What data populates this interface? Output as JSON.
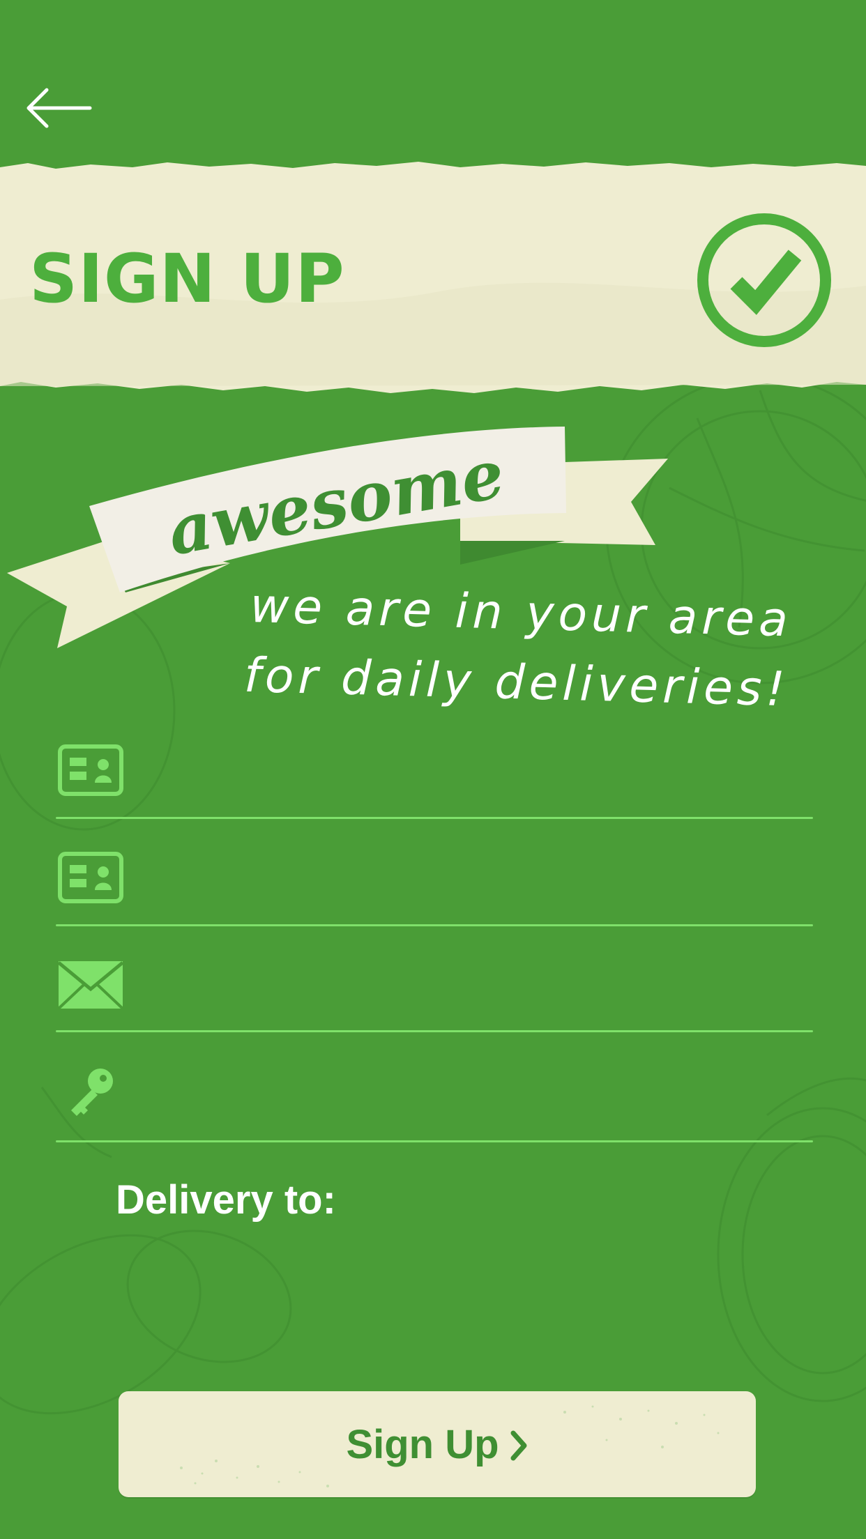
{
  "header": {
    "title": "SIGN UP",
    "back_icon": "arrow-left-icon",
    "confirm_icon": "check-circle-icon"
  },
  "banner": {
    "word": "awesome",
    "tagline_line1": "we are in your area",
    "tagline_line2": "for daily deliveries!"
  },
  "form": {
    "fields": [
      {
        "icon": "id-card-icon",
        "value": "",
        "placeholder": ""
      },
      {
        "icon": "id-card-icon",
        "value": "",
        "placeholder": ""
      },
      {
        "icon": "envelope-icon",
        "value": "",
        "placeholder": ""
      },
      {
        "icon": "key-icon",
        "value": "",
        "placeholder": ""
      }
    ],
    "delivery_label": "Delivery to:"
  },
  "actions": {
    "signup_label": "Sign Up",
    "signup_icon": "chevron-right-icon"
  },
  "colors": {
    "background": "#4a9d37",
    "paper": "#efedd1",
    "accent": "#4daf3d",
    "field_line": "#7fe16a",
    "icon": "#7fe16a"
  }
}
